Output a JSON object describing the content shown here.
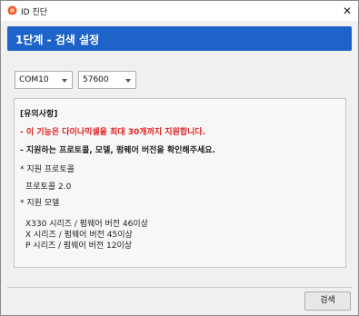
{
  "window": {
    "title": "ID 진단",
    "close_glyph": "✕",
    "icon": "app-icon"
  },
  "step": {
    "title": "1단계 - 검색 설정"
  },
  "settings": {
    "port": "COM10",
    "baud": "57600"
  },
  "notice": {
    "heading": "[유의사항]",
    "warning": "- 이 기능은 다이나믹셀을 최대 30개까지 지원합니다.",
    "check": "- 지원하는 프로토콜, 모델, 펌웨어 버전을 확인해주세요.",
    "protocol_heading": "* 지원 프로토콜",
    "protocol_value": "프로토콜 2.0",
    "model_heading": "* 지원 모델",
    "models": [
      "X330 시리즈 / 펌웨어 버전 46이상",
      "X 시리즈 / 펌웨어 버전 45이상",
      "P 시리즈 / 펌웨어 버전 12이상"
    ]
  },
  "buttons": {
    "search": "검색"
  },
  "colors": {
    "accent": "#1e64c8",
    "warning": "#e02020"
  }
}
